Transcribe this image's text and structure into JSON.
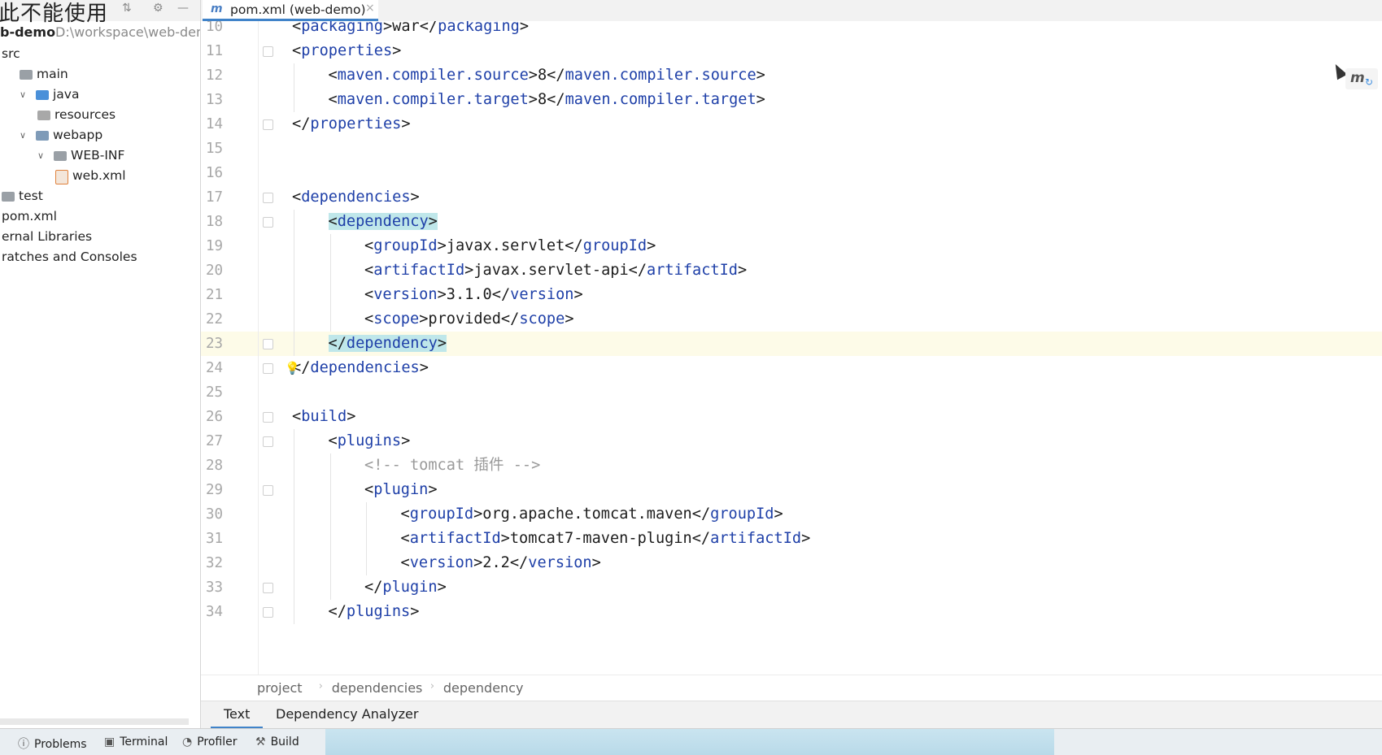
{
  "sidebar": {
    "overlay_title": "此不能使用",
    "project_name": "b-demo",
    "project_path": "D:\\workspace\\web-dem",
    "tree": [
      {
        "label": "src",
        "indent": 0,
        "arrow": "",
        "icon": "none"
      },
      {
        "label": "main",
        "indent": 1,
        "arrow": "",
        "icon": "folder"
      },
      {
        "label": "java",
        "indent": 1,
        "arrow": "v",
        "icon": "folder-blue"
      },
      {
        "label": "resources",
        "indent": 2,
        "arrow": "",
        "icon": "folder-res"
      },
      {
        "label": "webapp",
        "indent": 1,
        "arrow": "v",
        "icon": "folder-web"
      },
      {
        "label": "WEB-INF",
        "indent": 2,
        "arrow": "v",
        "icon": "folder"
      },
      {
        "label": "web.xml",
        "indent": 3,
        "arrow": "",
        "icon": "xml-file"
      },
      {
        "label": "test",
        "indent": 0,
        "arrow": "",
        "icon": "folder"
      },
      {
        "label": "pom.xml",
        "indent": 0,
        "arrow": "",
        "icon": "none"
      },
      {
        "label": "ernal Libraries",
        "indent": 0,
        "arrow": "",
        "icon": "none"
      },
      {
        "label": "ratches and Consoles",
        "indent": 0,
        "arrow": "",
        "icon": "none"
      }
    ]
  },
  "editor": {
    "tab_label": "pom.xml (web-demo)",
    "tab_icon": "m",
    "lines": [
      {
        "n": "10",
        "level": 1,
        "parts": [
          [
            "t",
            "<"
          ],
          [
            "k",
            "packaging"
          ],
          [
            "t",
            ">war</"
          ],
          [
            "k",
            "packaging"
          ],
          [
            "t",
            ">"
          ]
        ]
      },
      {
        "n": "11",
        "level": 1,
        "parts": [
          [
            "t",
            "<"
          ],
          [
            "k",
            "properties"
          ],
          [
            "t",
            ">"
          ]
        ]
      },
      {
        "n": "12",
        "level": 2,
        "parts": [
          [
            "t",
            "<"
          ],
          [
            "k",
            "maven.compiler.source"
          ],
          [
            "t",
            ">8</"
          ],
          [
            "k",
            "maven.compiler.source"
          ],
          [
            "t",
            ">"
          ]
        ]
      },
      {
        "n": "13",
        "level": 2,
        "parts": [
          [
            "t",
            "<"
          ],
          [
            "k",
            "maven.compiler.target"
          ],
          [
            "t",
            ">8</"
          ],
          [
            "k",
            "maven.compiler.target"
          ],
          [
            "t",
            ">"
          ]
        ]
      },
      {
        "n": "14",
        "level": 1,
        "parts": [
          [
            "t",
            "</"
          ],
          [
            "k",
            "properties"
          ],
          [
            "t",
            ">"
          ]
        ]
      },
      {
        "n": "15",
        "level": 0,
        "parts": []
      },
      {
        "n": "16",
        "level": 0,
        "parts": []
      },
      {
        "n": "17",
        "level": 1,
        "parts": [
          [
            "t",
            "<"
          ],
          [
            "k",
            "dependencies"
          ],
          [
            "t",
            ">"
          ]
        ]
      },
      {
        "n": "18",
        "level": 2,
        "parts": [
          [
            "h",
            "<"
          ],
          [
            "hk",
            "dependency"
          ],
          [
            "h",
            ">"
          ]
        ]
      },
      {
        "n": "19",
        "level": 3,
        "parts": [
          [
            "t",
            "<"
          ],
          [
            "k",
            "groupId"
          ],
          [
            "t",
            ">javax.servlet</"
          ],
          [
            "k",
            "groupId"
          ],
          [
            "t",
            ">"
          ]
        ]
      },
      {
        "n": "20",
        "level": 3,
        "parts": [
          [
            "t",
            "<"
          ],
          [
            "k",
            "artifactId"
          ],
          [
            "t",
            ">javax.servlet-api</"
          ],
          [
            "k",
            "artifactId"
          ],
          [
            "t",
            ">"
          ]
        ]
      },
      {
        "n": "21",
        "level": 3,
        "parts": [
          [
            "t",
            "<"
          ],
          [
            "k",
            "version"
          ],
          [
            "t",
            ">3.1.0</"
          ],
          [
            "k",
            "version"
          ],
          [
            "t",
            ">"
          ]
        ]
      },
      {
        "n": "22",
        "level": 3,
        "parts": [
          [
            "t",
            "<"
          ],
          [
            "k",
            "scope"
          ],
          [
            "t",
            ">provided</"
          ],
          [
            "k",
            "scope"
          ],
          [
            "t",
            ">"
          ]
        ]
      },
      {
        "n": "23",
        "level": 2,
        "parts": [
          [
            "h",
            "</"
          ],
          [
            "hk",
            "dependency"
          ],
          [
            "h",
            ">"
          ]
        ]
      },
      {
        "n": "24",
        "level": 1,
        "parts": [
          [
            "t",
            "</"
          ],
          [
            "k",
            "dependencies"
          ],
          [
            "t",
            ">"
          ]
        ]
      },
      {
        "n": "25",
        "level": 0,
        "parts": []
      },
      {
        "n": "26",
        "level": 1,
        "parts": [
          [
            "t",
            "<"
          ],
          [
            "k",
            "build"
          ],
          [
            "t",
            ">"
          ]
        ]
      },
      {
        "n": "27",
        "level": 2,
        "parts": [
          [
            "t",
            "<"
          ],
          [
            "k",
            "plugins"
          ],
          [
            "t",
            ">"
          ]
        ]
      },
      {
        "n": "28",
        "level": 3,
        "parts": [
          [
            "c",
            "<!-- tomcat 插件 -->"
          ]
        ]
      },
      {
        "n": "29",
        "level": 3,
        "parts": [
          [
            "t",
            "<"
          ],
          [
            "k",
            "plugin"
          ],
          [
            "t",
            ">"
          ]
        ]
      },
      {
        "n": "30",
        "level": 4,
        "parts": [
          [
            "t",
            "<"
          ],
          [
            "k",
            "groupId"
          ],
          [
            "t",
            ">org.apache.tomcat.maven</"
          ],
          [
            "k",
            "groupId"
          ],
          [
            "t",
            ">"
          ]
        ]
      },
      {
        "n": "31",
        "level": 4,
        "parts": [
          [
            "t",
            "<"
          ],
          [
            "k",
            "artifactId"
          ],
          [
            "t",
            ">tomcat7-maven-plugin</"
          ],
          [
            "k",
            "artifactId"
          ],
          [
            "t",
            ">"
          ]
        ]
      },
      {
        "n": "32",
        "level": 4,
        "parts": [
          [
            "t",
            "<"
          ],
          [
            "k",
            "version"
          ],
          [
            "t",
            ">2.2</"
          ],
          [
            "k",
            "version"
          ],
          [
            "t",
            ">"
          ]
        ]
      },
      {
        "n": "33",
        "level": 3,
        "parts": [
          [
            "t",
            "</"
          ],
          [
            "k",
            "plugin"
          ],
          [
            "t",
            ">"
          ]
        ]
      },
      {
        "n": "34",
        "level": 2,
        "parts": [
          [
            "t",
            "</"
          ],
          [
            "k",
            "plugins"
          ],
          [
            "t",
            ">"
          ]
        ]
      }
    ],
    "current_line": "23",
    "fold_lines": [
      "11",
      "14",
      "17",
      "18",
      "23",
      "24",
      "26",
      "27",
      "29",
      "33",
      "34"
    ]
  },
  "breadcrumb": [
    "project",
    "dependencies",
    "dependency"
  ],
  "bottom_tabs": {
    "text": "Text",
    "analyzer": "Dependency Analyzer"
  },
  "tool_windows": [
    {
      "label": "Problems",
      "icon": "info-icon"
    },
    {
      "label": "Terminal",
      "icon": "terminal-icon"
    },
    {
      "label": "Profiler",
      "icon": "profiler-icon"
    },
    {
      "label": "Build",
      "icon": "hammer-icon"
    }
  ],
  "colors": {
    "tag": "#1f40a8",
    "match_highlight": "#bfe7ea",
    "current_line": "#fdfbe8",
    "accent": "#4083c9"
  }
}
